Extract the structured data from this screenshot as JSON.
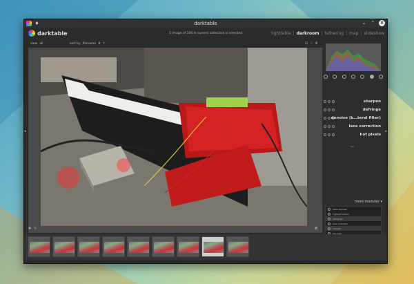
{
  "window": {
    "title": "darktable"
  },
  "header": {
    "app_name": "darktable",
    "status": "1 image of 106 in current collection is selected",
    "views": {
      "lighttable": "lighttable",
      "darkroom": "darkroom",
      "tethering": "tethering",
      "map": "map",
      "slideshow": "slideshow",
      "separator": "|"
    }
  },
  "toolbar": {
    "view_label": "view",
    "view_value": "all",
    "sort_label": "sort by",
    "sort_value": "filename"
  },
  "modules": {
    "items": [
      {
        "name": "sharpen"
      },
      {
        "name": "defringe"
      },
      {
        "name": "denoise (b…teral filter)"
      },
      {
        "name": "lens correction"
      },
      {
        "name": "hot pixels"
      }
    ],
    "more_modules": "more modules",
    "list": [
      "haze removal",
      "highlight reduct.",
      "histogram",
      "lens correction",
      "colorize",
      "low-pass",
      "profile"
    ]
  },
  "filmstrip": {
    "thumbnail_count": 9,
    "selected_index": 7
  },
  "colors": {
    "bg": "#2a2a2a",
    "panel": "#2d2d2d",
    "accent_red": "#d42020"
  }
}
